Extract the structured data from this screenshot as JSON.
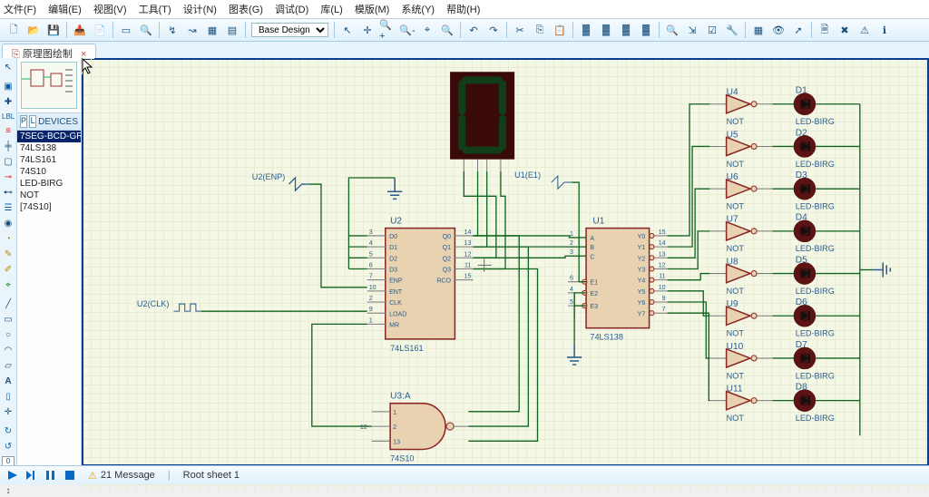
{
  "menu": [
    "文件(F)",
    "编辑(E)",
    "视图(V)",
    "工具(T)",
    "设计(N)",
    "图表(G)",
    "调试(D)",
    "库(L)",
    "模版(M)",
    "系统(Y)",
    "帮助(H)"
  ],
  "combo": "Base Design",
  "tab": {
    "label": "原理图绘制",
    "close": "×"
  },
  "devicesHeader": "DEVICES",
  "devices": [
    "7SEG-BCD-GRN",
    "74LS138",
    "74LS161",
    "74S10",
    "LED-BIRG",
    "NOT",
    "[74S10]"
  ],
  "probes": {
    "u2enp": "U2(ENP)",
    "u2clk": "U2(CLK)",
    "u1e1": "U1(E1)"
  },
  "u2": {
    "ref": "U2",
    "part": "74LS161",
    "left": [
      [
        "3",
        "D0"
      ],
      [
        "4",
        "D1"
      ],
      [
        "5",
        "D2"
      ],
      [
        "6",
        "D3"
      ],
      [
        "7",
        "ENP"
      ],
      [
        "10",
        "ENT"
      ],
      [
        "2",
        "CLK"
      ],
      [
        "9",
        "LOAD"
      ],
      [
        "1",
        "MR"
      ]
    ],
    "right": [
      [
        "Q0",
        "14"
      ],
      [
        "Q1",
        "13"
      ],
      [
        "Q2",
        "12"
      ],
      [
        "Q3",
        "11"
      ],
      [
        "RCO",
        "15"
      ]
    ]
  },
  "u1": {
    "ref": "U1",
    "part": "74LS138",
    "left": [
      [
        "1",
        "A"
      ],
      [
        "2",
        "B"
      ],
      [
        "3",
        "C"
      ],
      [
        "6",
        "E1"
      ],
      [
        "4",
        "E2"
      ],
      [
        "5",
        "E3"
      ]
    ],
    "right": [
      [
        "Y0",
        "15"
      ],
      [
        "Y1",
        "14"
      ],
      [
        "Y2",
        "13"
      ],
      [
        "Y3",
        "12"
      ],
      [
        "Y4",
        "11"
      ],
      [
        "Y5",
        "10"
      ],
      [
        "Y6",
        "9"
      ],
      [
        "Y7",
        "7"
      ]
    ]
  },
  "u3": {
    "ref": "U3:A",
    "part": "74S10",
    "inpins": [
      "1",
      "2",
      "13"
    ],
    "outpin": "12"
  },
  "inverters": [
    {
      "ref": "U4"
    },
    {
      "ref": "U5"
    },
    {
      "ref": "U6"
    },
    {
      "ref": "U7"
    },
    {
      "ref": "U8"
    },
    {
      "ref": "U9"
    },
    {
      "ref": "U10"
    },
    {
      "ref": "U11"
    }
  ],
  "notLabel": "NOT",
  "leds": [
    {
      "ref": "D1"
    },
    {
      "ref": "D2"
    },
    {
      "ref": "D3"
    },
    {
      "ref": "D4"
    },
    {
      "ref": "D5"
    },
    {
      "ref": "D6"
    },
    {
      "ref": "D7"
    },
    {
      "ref": "D8"
    }
  ],
  "ledPart": "LED-BIRG",
  "status": {
    "msg": "21 Message",
    "sheet": "Root sheet 1"
  }
}
